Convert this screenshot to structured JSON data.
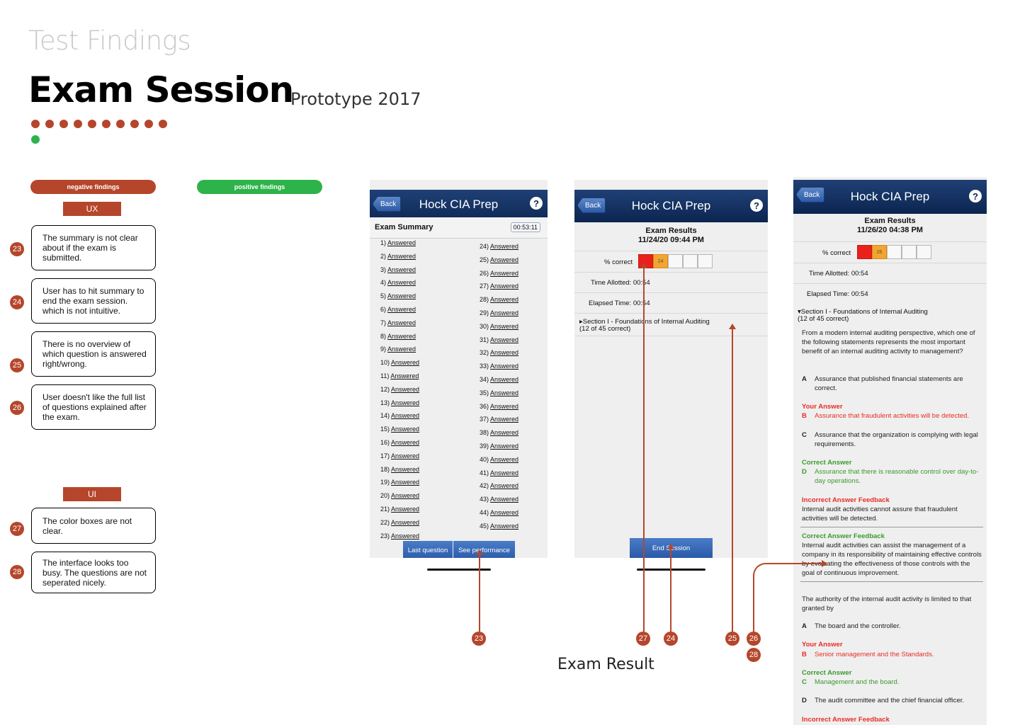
{
  "header": {
    "kicker": "Test Findings",
    "title": "Exam Session",
    "subtitle": "Prototype 2017"
  },
  "findings": {
    "negative_label": "negative findings",
    "positive_label": "positive findings",
    "ux_label": "UX",
    "ui_label": "UI",
    "ux_cards": [
      {
        "num": "23",
        "text": "The summary is not clear about if the exam is submitted."
      },
      {
        "num": "24",
        "text": "User has to hit summary to end the exam session. which is not intuitive."
      },
      {
        "num": "25",
        "text": "There is no overview of which question is answered right/wrong."
      },
      {
        "num": "26",
        "text": "User doesn't like the full list of questions explained after the exam."
      }
    ],
    "ui_cards": [
      {
        "num": "27",
        "text": "The color boxes are not clear."
      },
      {
        "num": "28",
        "text": "The interface looks too busy.  The questions are not seperated nicely."
      }
    ]
  },
  "app": {
    "back_label": "Back",
    "title": "Hock CIA Prep",
    "help_glyph": "?"
  },
  "summary_screen": {
    "title": "Exam Summary",
    "timer": "00:53:11",
    "left_questions": [
      "1)",
      "2)",
      "3)",
      "4)",
      "5)",
      "6)",
      "7)",
      "8)",
      "9)",
      "10)",
      "11)",
      "12)",
      "13)",
      "14)",
      "15)",
      "16)",
      "17)",
      "18)",
      "19)",
      "20)",
      "21)",
      "22)",
      "23)"
    ],
    "right_questions": [
      "24)",
      "25)",
      "26)",
      "27)",
      "28)",
      "29)",
      "30)",
      "31)",
      "32)",
      "33)",
      "34)",
      "35)",
      "36)",
      "37)",
      "38)",
      "39)",
      "40)",
      "41)",
      "42)",
      "43)",
      "44)",
      "45)"
    ],
    "status": "Answered",
    "btn_last": "Last question",
    "btn_perf": "See performance"
  },
  "results_screen": {
    "title": "Exam Results",
    "date": "11/24/20 09:44 PM",
    "pct_label": "% correct",
    "pct_value": "24",
    "time_allotted": "Time Allotted:  00:54",
    "elapsed": "Elapsed Time:  00:54",
    "section": "Section I - Foundations of Internal Auditing",
    "section_count": "(12 of 45 correct)",
    "end_btn": "End Session"
  },
  "results_screen2": {
    "title": "Exam Results",
    "date": "11/26/20 04:38 PM",
    "pct_label": "% correct",
    "pct_value": "26",
    "time_allotted": "Time Allotted:  00:54",
    "elapsed": "Elapsed Time:  00:54",
    "section": "Section I - Foundations of Internal Auditing",
    "section_count": "(12 of 45 correct)",
    "q1": "From a modern internal auditing perspective, which one of the following statements represents the most important benefit of an internal auditing activity to management?",
    "q1_a": "Assurance that published financial statements are correct.",
    "your_answer_label": "Your Answer",
    "q1_b": "Assurance that fraudulent activities will be detected.",
    "q1_c": "Assurance that the organization is complying with legal requirements.",
    "correct_answer_label": "Correct Answer",
    "q1_d": "Assurance that there is reasonable control over day-to-day operations.",
    "incorrect_feedback_label": "Incorrect Answer Feedback",
    "q1_incorrect_feedback": "Internal audit activities cannot assure that fraudulent activities will be detected.",
    "correct_feedback_label": "Correct Answer Feedback",
    "q1_correct_feedback": "Internal audit activities can assist the management of a company in its responsibility of maintaining effective controls by evaluating the effectiveness of those controls with the goal of continuous improvement.",
    "q2": "The authority of the internal audit activity is limited to that granted by",
    "q2_a": "The board and the controller.",
    "q2_b": "Senior management and the Standards.",
    "q2_c": "Management and the board.",
    "q2_d": "The audit committee and the chief financial officer.",
    "letters": {
      "a": "A",
      "b": "B",
      "c": "C",
      "d": "D"
    }
  },
  "annotations": {
    "n23": "23",
    "n24": "24",
    "n25": "25",
    "n26": "26",
    "n27": "27",
    "n28": "28"
  },
  "caption": "Exam Result",
  "colors": {
    "accent": "#b5462b",
    "positive": "#2db34a",
    "navbar": "#0c2550"
  }
}
